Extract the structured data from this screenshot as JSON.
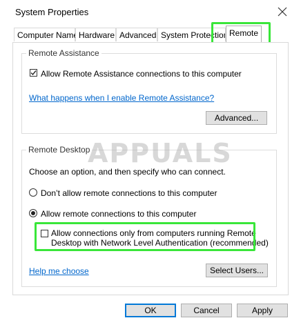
{
  "window": {
    "title": "System Properties",
    "close_icon": "close-icon"
  },
  "tabs": [
    {
      "label": "Computer Name",
      "active": false
    },
    {
      "label": "Hardware",
      "active": false
    },
    {
      "label": "Advanced",
      "active": false
    },
    {
      "label": "System Protection",
      "active": false
    },
    {
      "label": "Remote",
      "active": true
    }
  ],
  "remote_assistance": {
    "title": "Remote Assistance",
    "allow_label": "Allow Remote Assistance connections to this computer",
    "allow_checked": true,
    "help_link": "What happens when I enable Remote Assistance?",
    "advanced_button": "Advanced..."
  },
  "remote_desktop": {
    "title": "Remote Desktop",
    "description": "Choose an option, and then specify who can connect.",
    "option_deny": "Don’t allow remote connections to this computer",
    "option_allow": "Allow remote connections to this computer",
    "selected": "allow",
    "nla_line1": "Allow connections only from computers running Remote",
    "nla_line2": "Desktop with Network Level Authentication (recommended)",
    "nla_checked": false,
    "help_link": "Help me choose",
    "select_users_button": "Select Users..."
  },
  "dialog_buttons": {
    "ok": "OK",
    "cancel": "Cancel",
    "apply": "Apply"
  },
  "watermark": "APPUALS",
  "colors": {
    "highlight": "#39e639",
    "link": "#0066cc",
    "default_button_border": "#0078d7"
  }
}
